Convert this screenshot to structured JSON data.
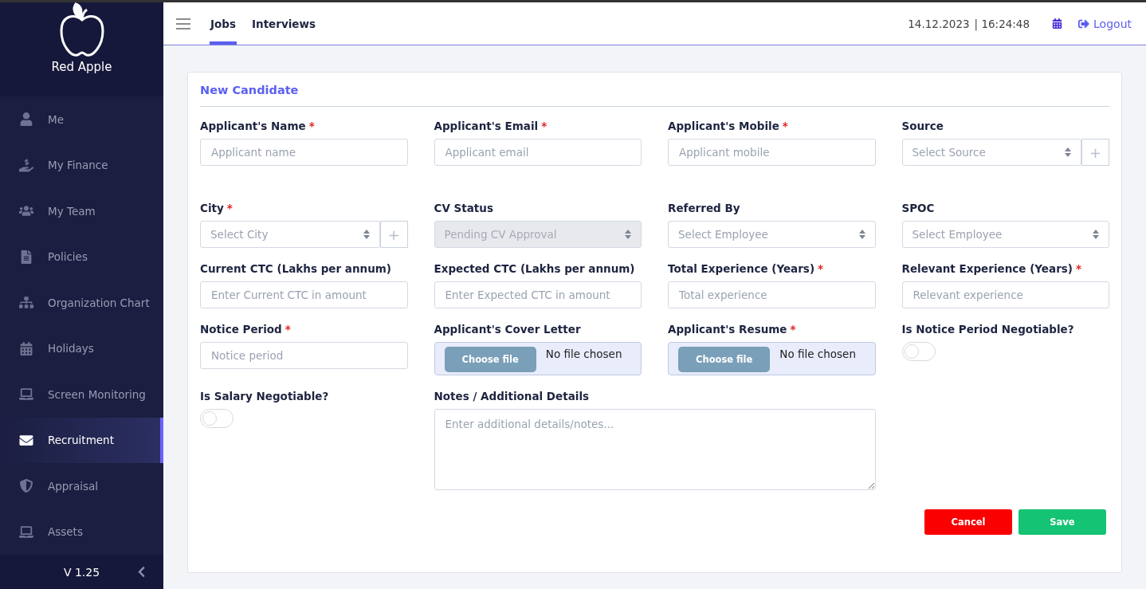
{
  "brand": {
    "name": "Red Apple"
  },
  "sidebar": {
    "items": [
      {
        "label": "Me",
        "selected": false
      },
      {
        "label": "My Finance",
        "selected": false
      },
      {
        "label": "My Team",
        "selected": false
      },
      {
        "label": "Policies",
        "selected": false
      },
      {
        "label": "Organization Chart",
        "selected": false
      },
      {
        "label": "Holidays",
        "selected": false
      },
      {
        "label": "Screen Monitoring",
        "selected": false
      },
      {
        "label": "Recruitment",
        "selected": true
      },
      {
        "label": "Appraisal",
        "selected": false
      },
      {
        "label": "Assets",
        "selected": false
      }
    ],
    "version": "V 1.25"
  },
  "header": {
    "tabs": [
      {
        "label": "Jobs",
        "selected": true
      },
      {
        "label": "Interviews",
        "selected": false
      }
    ],
    "date": "14.12.2023",
    "time": "| 16:24:48",
    "logout": "Logout"
  },
  "form": {
    "title": "New Candidate",
    "rows": [
      [
        {
          "kind": "text",
          "label": "Applicant's Name",
          "required_mark": "*",
          "placeholder": "Applicant name"
        },
        {
          "kind": "text",
          "label": "Applicant's Email",
          "required_mark": "*",
          "placeholder": "Applicant email"
        },
        {
          "kind": "text",
          "label": "Applicant's Mobile",
          "required_mark": "*",
          "placeholder": "Applicant mobile"
        },
        {
          "kind": "select",
          "label": "Source",
          "placeholder": "Select Source",
          "add_button": "+",
          "disabled": false
        }
      ],
      [
        {
          "kind": "select",
          "label": "City",
          "required_mark": "*",
          "placeholder": "Select City",
          "add_button": "+",
          "disabled": false
        },
        {
          "kind": "select",
          "label": "CV Status",
          "placeholder": "Pending CV Approval",
          "disabled": true
        },
        {
          "kind": "select",
          "label": "Referred By",
          "placeholder": "Select Employee",
          "disabled": false
        },
        {
          "kind": "select",
          "label": "SPOC",
          "placeholder": "Select Employee",
          "disabled": false
        }
      ],
      [
        {
          "kind": "text",
          "label": "Current CTC (Lakhs per annum)",
          "placeholder": "Enter Current CTC in amount"
        },
        {
          "kind": "text",
          "label": "Expected CTC (Lakhs per annum)",
          "placeholder": "Enter Expected CTC in amount"
        },
        {
          "kind": "text",
          "label": "Total Experience (Years)",
          "required_mark": "*",
          "placeholder": "Total experience"
        },
        {
          "kind": "text",
          "label": "Relevant Experience (Years)",
          "required_mark": "*",
          "placeholder": "Relevant experience"
        }
      ],
      [
        {
          "kind": "text",
          "label": "Notice Period",
          "required_mark": "*",
          "placeholder": "Notice period"
        },
        {
          "kind": "file",
          "label": "Applicant's Cover Letter",
          "button": "Choose file",
          "status": "No file chosen"
        },
        {
          "kind": "file",
          "label": "Applicant's Resume",
          "required_mark": "*",
          "button": "Choose file",
          "status": "No file chosen"
        },
        {
          "kind": "toggle",
          "label": "Is Notice Period Negotiable?",
          "on": false
        }
      ],
      [
        {
          "kind": "toggle",
          "label": "Is Salary Negotiable?",
          "on": false
        },
        {
          "kind": "textarea",
          "label": "Notes / Additional Details",
          "placeholder": "Enter additional details/notes..."
        }
      ]
    ],
    "buttons": [
      {
        "kind": "cancel",
        "label": "Cancel"
      },
      {
        "kind": "save",
        "label": "Save"
      }
    ]
  }
}
